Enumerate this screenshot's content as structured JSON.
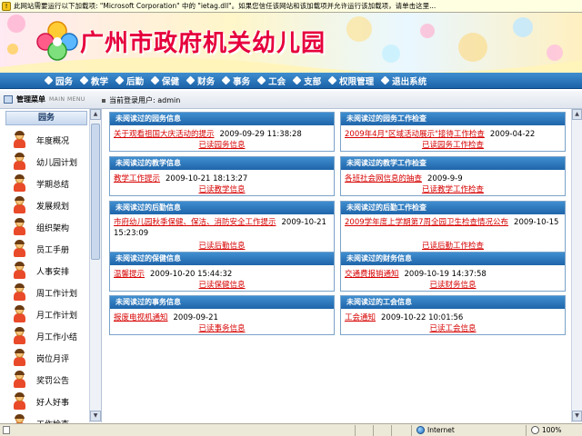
{
  "infobar": {
    "text": "此网站需要运行以下加载项: \"Microsoft Corporation\" 中的 \"ietag.dll\"。如果您信任该网站和该加载项并允许运行该加载项，请单击这里..."
  },
  "banner": {
    "title": "广州市政府机关幼儿园"
  },
  "nav": {
    "items": [
      "园务",
      "教学",
      "后勤",
      "保健",
      "财务",
      "事务",
      "工会",
      "支部",
      "权限管理",
      "退出系统"
    ]
  },
  "subbar": {
    "mgmt_label": "管理菜单",
    "mgmt_en": "MAIN MENU",
    "current_user": "当前登录用户: admin"
  },
  "sidebar": {
    "header": "园务",
    "items": [
      "年度概况",
      "幼儿园计划",
      "学期总结",
      "发展规划",
      "组织架构",
      "员工手册",
      "人事安排",
      "周工作计划",
      "月工作计划",
      "月工作小结",
      "岗位月评",
      "奖罚公告",
      "好人好事",
      "工作检查"
    ]
  },
  "panels": [
    {
      "title": "未阅读过的园务信息",
      "link": "关于观看祖国大庆活动的提示",
      "date": "2009-09-29 11:38:28",
      "more": "已读园务信息"
    },
    {
      "title": "未阅读过的园务工作检查",
      "link": "2009年4月\"区域活动展示\"接待工作检查",
      "date": "2009-04-22",
      "more": "已读园务工作检查"
    },
    {
      "title": "未阅读过的教学信息",
      "link": "教学工作提示",
      "date": "2009-10-21 18:13:27",
      "more": "已读教学信息"
    },
    {
      "title": "未阅读过的教学工作检查",
      "link": "各班社会网信息的抽查",
      "date": "2009-9-9",
      "more": "已读教学工作检查"
    },
    {
      "title": "未阅读过的后勤信息",
      "link": "市府幼儿园秋季保健、保洁、消防安全工作提示",
      "date": "2009-10-21 15:23:09",
      "more": "已读后勤信息"
    },
    {
      "title": "未阅读过的后勤工作检查",
      "link": "2009学年度上学期第7周全园卫生检查情况公布",
      "date": "2009-10-15",
      "more": "已读后勤工作检查"
    },
    {
      "title": "未阅读过的保健信息",
      "link": "温馨提示",
      "date": "2009-10-20 15:44:32",
      "more": "已读保健信息"
    },
    {
      "title": "未阅读过的财务信息",
      "link": "交通费报销通知",
      "date": "2009-10-19 14:37:58",
      "more": "已读财务信息"
    },
    {
      "title": "未阅读过的事务信息",
      "link": "报废电视机通知",
      "date": "2009-09-21",
      "more": "已读事务信息"
    },
    {
      "title": "未阅读过的工会信息",
      "link": "工会通知",
      "date": "2009-10-22 10:01:56",
      "more": "已读工会信息"
    }
  ],
  "statusbar": {
    "zone": "Internet",
    "zoom": "100%"
  }
}
